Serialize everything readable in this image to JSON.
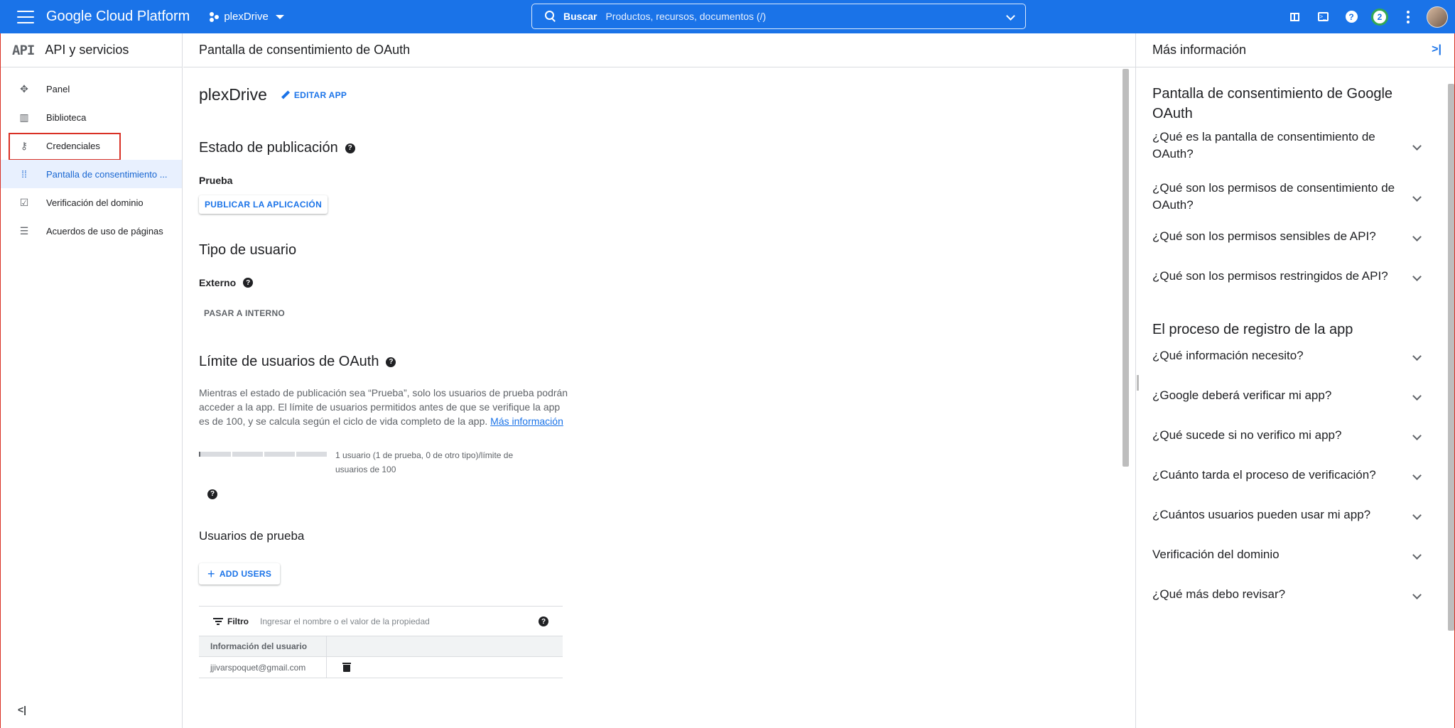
{
  "topbar": {
    "logo": "Google Cloud Platform",
    "project": "plexDrive",
    "search_label": "Buscar",
    "search_placeholder": "Productos, recursos, documentos (/)",
    "notifications": "2"
  },
  "sidebar": {
    "logo": "API",
    "title": "API y servicios",
    "items": [
      {
        "label": "Panel",
        "icon": "dashboard-icon"
      },
      {
        "label": "Biblioteca",
        "icon": "library-icon"
      },
      {
        "label": "Credenciales",
        "icon": "key-icon"
      },
      {
        "label": "Pantalla de consentimiento ...",
        "icon": "consent-icon"
      },
      {
        "label": "Verificación del dominio",
        "icon": "domain-check-icon"
      },
      {
        "label": "Acuerdos de uso de páginas",
        "icon": "settings-list-icon"
      }
    ],
    "collapse": "<|"
  },
  "main": {
    "header": "Pantalla de consentimiento de OAuth",
    "app_name": "plexDrive",
    "edit_label": "EDITAR APP",
    "publish": {
      "title": "Estado de publicación",
      "status": "Prueba",
      "button": "PUBLICAR LA APLICACIÓN"
    },
    "user_type": {
      "title": "Tipo de usuario",
      "value": "Externo",
      "button": "PASAR A INTERNO"
    },
    "limit": {
      "title": "Límite de usuarios de OAuth",
      "text": "Mientras el estado de publicación sea “Prueba”, solo los usuarios de prueba podrán acceder a la app. El límite de usuarios permitidos antes de que se verifique la app es de 100, y se calcula según el ciclo de vida completo de la app.",
      "link": "Más información",
      "usage_text": "1 usuario (1 de prueba, 0 de otro tipo)/límite de usuarios de 100"
    },
    "test_users": {
      "title": "Usuarios de prueba",
      "add_button": "ADD USERS",
      "filter_label": "Filtro",
      "filter_placeholder": "Ingresar el nombre o el valor de la propiedad",
      "column": "Información del usuario",
      "rows": [
        "jjivarspoquet@gmail.com"
      ]
    }
  },
  "right_panel": {
    "title": "Más información",
    "section1_title": "Pantalla de consentimiento de Google OAuth",
    "section1_items": [
      "¿Qué es la pantalla de consentimiento de OAuth?",
      "¿Qué son los permisos de consentimiento de OAuth?",
      "¿Qué son los permisos sensibles de API?",
      "¿Qué son los permisos restringidos de API?"
    ],
    "section2_title": "El proceso de registro de la app",
    "section2_items": [
      "¿Qué información necesito?",
      "¿Google deberá verificar mi app?",
      "¿Qué sucede si no verifico mi app?",
      "¿Cuánto tarda el proceso de verificación?",
      "¿Cuántos usuarios pueden usar mi app?",
      "Verificación del dominio",
      "¿Qué más debo revisar?"
    ]
  },
  "colors": {
    "accent": "#1a73e8",
    "highlight": "#d93025"
  }
}
